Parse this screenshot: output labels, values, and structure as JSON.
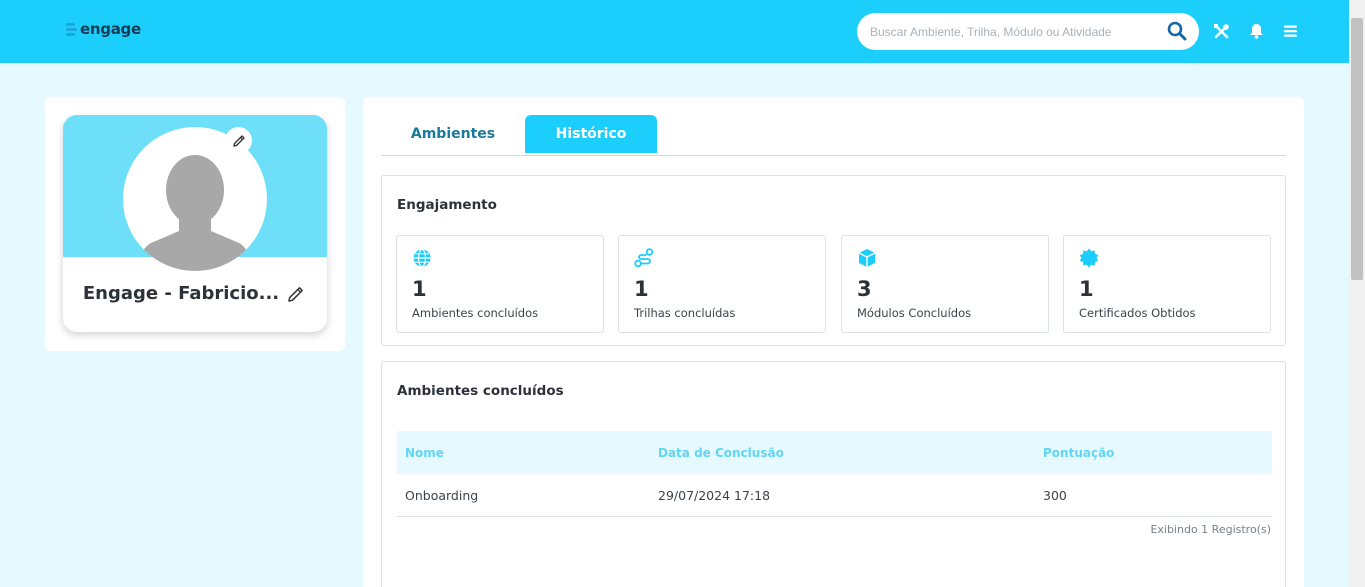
{
  "header": {
    "logo_text": "engage",
    "search_placeholder": "Buscar Ambiente, Trilha, Módulo ou Atividade",
    "icons": [
      "search-icon",
      "tools-icon",
      "bell-icon",
      "menu-icon"
    ],
    "color": "#1ccefc"
  },
  "profile": {
    "name": "Engage - Fabricio...",
    "banner_color": "#6ddff9"
  },
  "tabs": [
    {
      "label": "Ambientes",
      "active": false
    },
    {
      "label": "Histórico",
      "active": true
    }
  ],
  "engagement": {
    "title": "Engajamento",
    "stats": [
      {
        "icon": "globe-icon",
        "value": "1",
        "label": "Ambientes concluídos"
      },
      {
        "icon": "route-icon",
        "value": "1",
        "label": "Trilhas concluídas"
      },
      {
        "icon": "cube-icon",
        "value": "3",
        "label": "Módulos Concluídos"
      },
      {
        "icon": "certificate-icon",
        "value": "1",
        "label": "Certificados Obtidos"
      }
    ]
  },
  "completed": {
    "title": "Ambientes concluídos",
    "columns": [
      "Nome",
      "Data de Conclusão",
      "Pontuação"
    ],
    "rows": [
      [
        "Onboarding",
        "29/07/2024 17:18",
        "300"
      ]
    ],
    "footer": "Exibindo 1 Registro(s)"
  }
}
